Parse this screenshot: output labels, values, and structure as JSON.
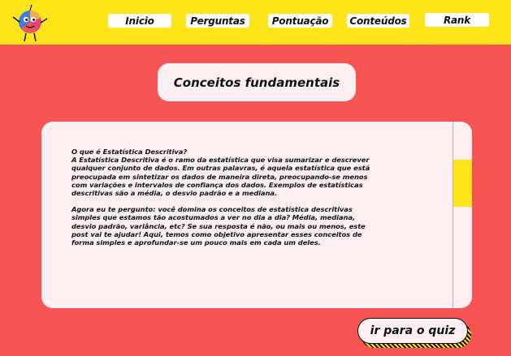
{
  "nav": {
    "items": [
      {
        "label": "Inicio"
      },
      {
        "label": "Perguntas"
      },
      {
        "label": "Pontuação"
      },
      {
        "label": "Conteúdos"
      },
      {
        "label": "Rank"
      }
    ]
  },
  "logo": {
    "icon": "mascot-logo-icon"
  },
  "main": {
    "title": "Conceitos fundamentais",
    "paragraphs": [
      "O que é Estatística Descritiva?\nA Estatística Descritiva é o ramo da estatística que visa sumarizar e descrever qualquer conjunto de dados. Em outras palavras, é aquela estatística que está preocupada em sintetizar os dados de maneira direta, preocupando-se menos com variações e intervalos de confiança dos dados. Exemplos de estatísticas descritivas são a média, o desvio padrão e a mediana.",
      "Agora eu te pergunto: você domina os conceitos de estatística descritivas simples que estamos tão acostumados a ver no dia a dia? Média, mediana, desvio padrão, variância, etc? Se sua resposta é não, ou mais ou menos, este post vai te ajudar! Aqui, temos como objetivo apresentar esses conceitos de forma simples e aprofundar-se um pouco mais em cada um deles."
    ],
    "quiz_button": "ir para o quiz"
  },
  "colors": {
    "background": "#F75454",
    "topbar": "#FFE41A",
    "card": "#FCEFF1",
    "accent": "#FFE41A",
    "text": "#111111"
  }
}
